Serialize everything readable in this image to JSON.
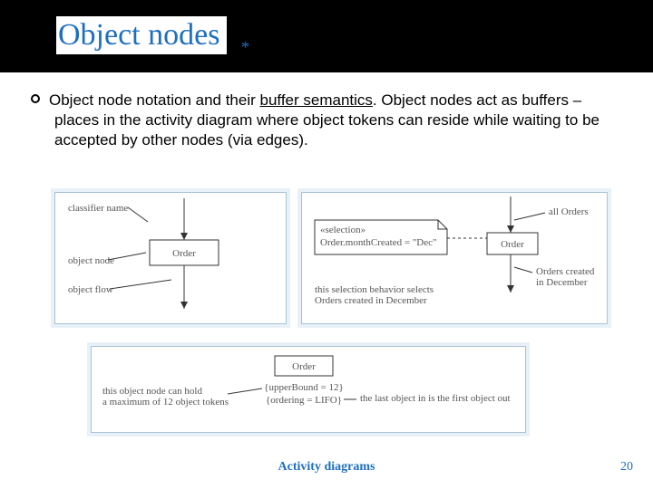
{
  "header": {
    "title": "Object nodes",
    "asterisk": "*"
  },
  "body": {
    "bullet_text_a": "Object node notation and their ",
    "bullet_text_b": "buffer semantics",
    "bullet_text_c": ". Object nodes act as buffers – places in the activity diagram where object tokens can reside while waiting to be accepted by other nodes (via edges)."
  },
  "diagram1": {
    "label_classifier": "classifier name",
    "label_object_node": "object node",
    "label_object_flow": "object flow",
    "node_text": "Order"
  },
  "diagram2": {
    "selection_stereotype": "«selection»",
    "selection_expr": "Order.monthCreated = \"Dec\"",
    "caption1": "this selection behavior selects",
    "caption2": "Orders created in December",
    "node_text": "Order",
    "right_label1": "all Orders",
    "right_label2a": "Orders created",
    "right_label2b": "in December"
  },
  "diagram3": {
    "node_text": "Order",
    "constraint1": "{upperBound = 12}",
    "constraint2": "{ordering = LIFO}",
    "left_label1": "this object node can hold",
    "left_label2": "a maximum of 12 object tokens",
    "right_label": "the last object in is the first object out"
  },
  "footer": {
    "text": "Activity diagrams",
    "page": "20"
  }
}
